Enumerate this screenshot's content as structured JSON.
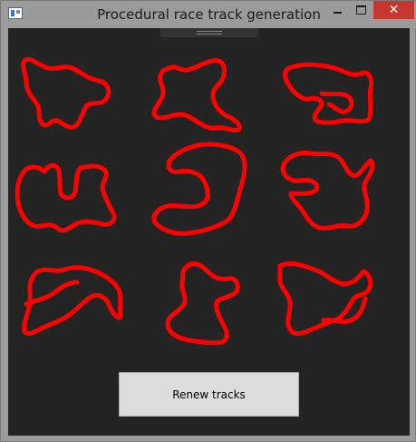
{
  "window": {
    "title": "Procedural race track generation",
    "icon": "app-window-icon",
    "controls": {
      "minimize_icon": "minimize-icon",
      "maximize_icon": "maximize-icon",
      "close_glyph": "✕"
    }
  },
  "colors": {
    "background": "#242424",
    "track": "#ff0000",
    "close_button": "#c7372f",
    "button_face": "#dcdcdc"
  },
  "tracks": {
    "count": 9
  },
  "actions": {
    "renew_label": "Renew tracks"
  }
}
